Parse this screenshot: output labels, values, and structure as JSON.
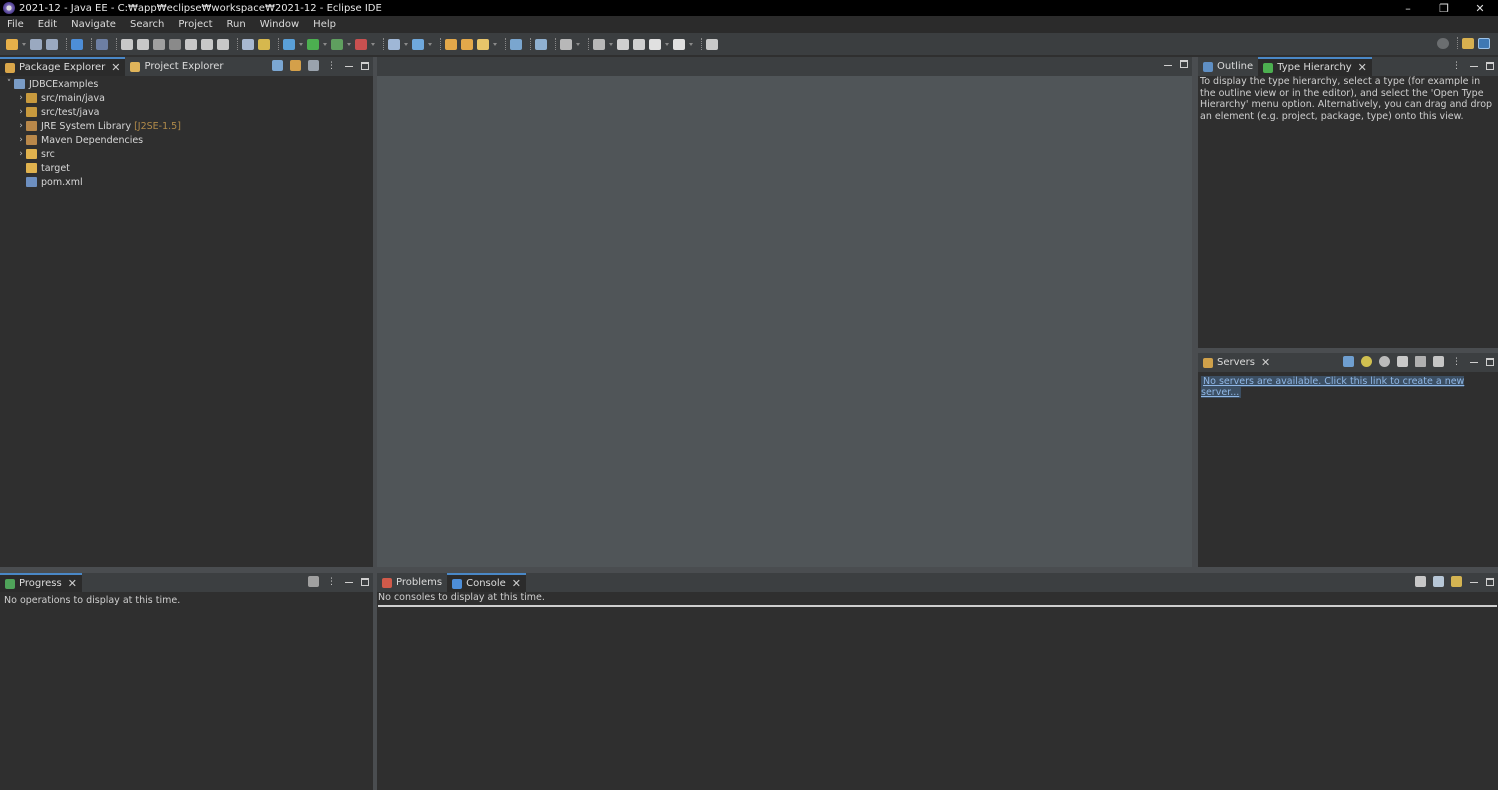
{
  "window": {
    "title": "2021-12 - Java EE - C:₩app₩eclipse₩workspace₩2021-12 - Eclipse IDE",
    "minimize": "–",
    "restore": "❐",
    "close": "✕"
  },
  "menu": [
    "File",
    "Edit",
    "Navigate",
    "Search",
    "Project",
    "Run",
    "Window",
    "Help"
  ],
  "colors": {
    "accent": "#4a88c7",
    "background": "#2f2f2f",
    "editor_area": "#505558",
    "tab_bar": "#3c3f41"
  },
  "package_explorer": {
    "tabs": [
      {
        "label": "Package Explorer",
        "close": "✕",
        "icon": "package-explorer-icon"
      },
      {
        "label": "Project Explorer",
        "icon": "project-explorer-icon"
      }
    ],
    "tree": {
      "project": "JDBCExamples",
      "items": [
        {
          "label": "src/main/java",
          "icon": "source-folder-icon",
          "expandable": true
        },
        {
          "label": "src/test/java",
          "icon": "source-folder-icon",
          "expandable": true
        },
        {
          "label": "JRE System Library",
          "decoration": "[J2SE-1.5]",
          "icon": "library-icon",
          "expandable": true
        },
        {
          "label": "Maven Dependencies",
          "icon": "library-icon",
          "expandable": true
        },
        {
          "label": "src",
          "icon": "folder-icon",
          "expandable": true
        },
        {
          "label": "target",
          "icon": "folder-icon",
          "expandable": false
        },
        {
          "label": "pom.xml",
          "icon": "xml-file-icon",
          "expandable": false
        }
      ]
    }
  },
  "outline_panel": {
    "tabs": [
      {
        "label": "Outline",
        "icon": "outline-icon"
      },
      {
        "label": "Type Hierarchy",
        "close": "✕",
        "icon": "type-hierarchy-icon"
      }
    ],
    "message": "To display the type hierarchy, select a type (for example in the outline view or in the editor), and select the 'Open Type Hierarchy' menu option. Alternatively, you can drag and drop an element (e.g. project, package, type) onto this view."
  },
  "servers_panel": {
    "tab": {
      "label": "Servers",
      "close": "✕",
      "icon": "servers-icon"
    },
    "link": "No servers are available. Click this link to create a new server..."
  },
  "progress_panel": {
    "tab": {
      "label": "Progress",
      "close": "✕",
      "icon": "progress-icon"
    },
    "message": "No operations to display at this time."
  },
  "console_panel": {
    "tabs": [
      {
        "label": "Problems",
        "icon": "problems-icon"
      },
      {
        "label": "Console",
        "close": "✕",
        "icon": "console-icon"
      }
    ],
    "message": "No consoles to display at this time."
  },
  "glyphs": {
    "view_menu": "⋮",
    "chevron_right": "›",
    "chevron_down": "˅"
  }
}
